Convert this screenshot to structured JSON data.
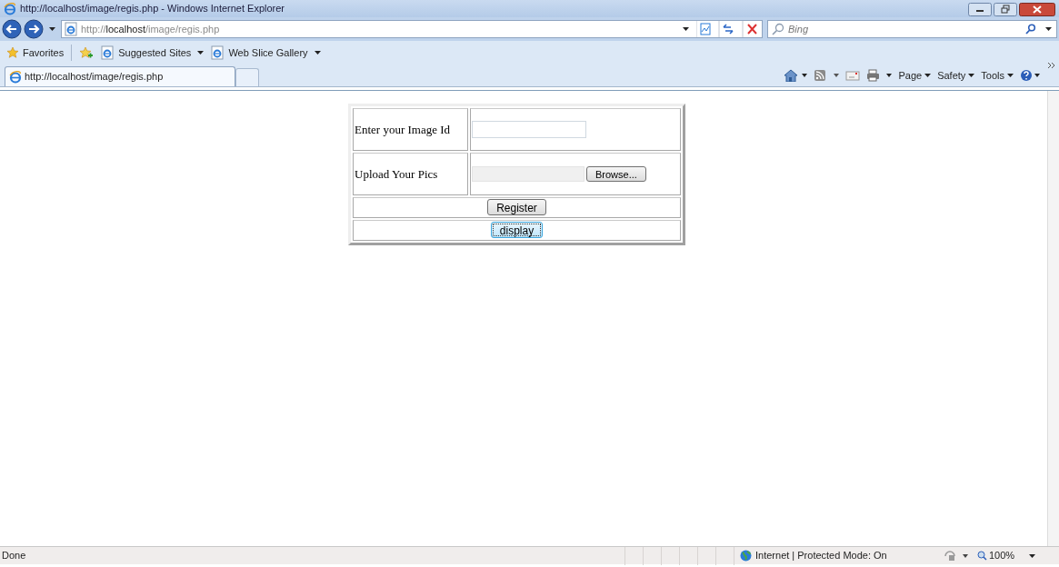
{
  "window": {
    "title": "http://localhost/image/regis.php - Windows Internet Explorer"
  },
  "address": {
    "scheme": "http://",
    "host": "localhost",
    "path": "/image/regis.php"
  },
  "search": {
    "placeholder": "Bing"
  },
  "favorites_bar": {
    "label": "Favorites",
    "links": [
      {
        "label": "Suggested Sites"
      },
      {
        "label": "Web Slice Gallery"
      }
    ]
  },
  "tabs": [
    {
      "label": "http://localhost/image/regis.php",
      "selected": true
    }
  ],
  "command_bar": [
    "Page",
    "Safety",
    "Tools"
  ],
  "form": {
    "rows": [
      {
        "kind": "text",
        "label": "Enter your Image Id"
      },
      {
        "kind": "file",
        "label": "Upload Your Pics",
        "button": "Browse..."
      },
      {
        "kind": "button",
        "button": "Register",
        "focused": false
      },
      {
        "kind": "button",
        "button": "display",
        "focused": true
      }
    ]
  },
  "status_bar": {
    "text": "Done",
    "zone": "Internet | Protected Mode: On",
    "zoom": "100%"
  }
}
